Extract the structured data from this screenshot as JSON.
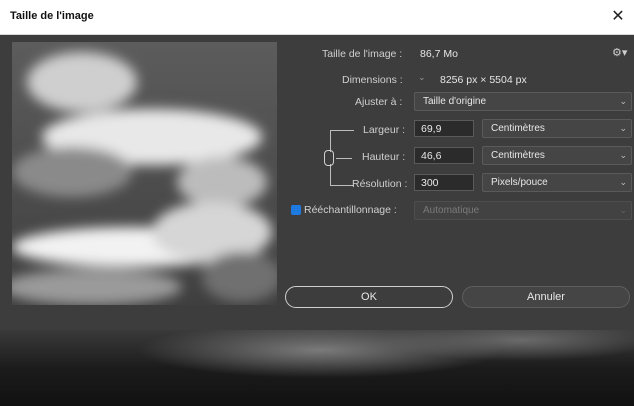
{
  "window": {
    "title": "Taille de l'image"
  },
  "image_size": {
    "label": "Taille de l'image :",
    "value": "86,7 Mo"
  },
  "dimensions": {
    "label": "Dimensions :",
    "value": "8256 px  ×  5504 px"
  },
  "fit_to": {
    "label": "Ajuster à :",
    "value": "Taille d'origine"
  },
  "width": {
    "label": "Largeur :",
    "value": "69,9",
    "unit": "Centimètres"
  },
  "height": {
    "label": "Hauteur :",
    "value": "46,6",
    "unit": "Centimètres"
  },
  "resolution": {
    "label": "Résolution :",
    "value": "300",
    "unit": "Pixels/pouce"
  },
  "resample": {
    "label": "Rééchantillonnage :",
    "value": "Automatique",
    "checked": true
  },
  "buttons": {
    "ok": "OK",
    "cancel": "Annuler"
  },
  "colors": {
    "accent": "#1f7ae0",
    "dialog_bg": "#3d3d3d"
  },
  "icons": [
    "close-icon",
    "gear-icon",
    "chain-link-icon",
    "chevron-down-icon",
    "checkbox-icon"
  ]
}
